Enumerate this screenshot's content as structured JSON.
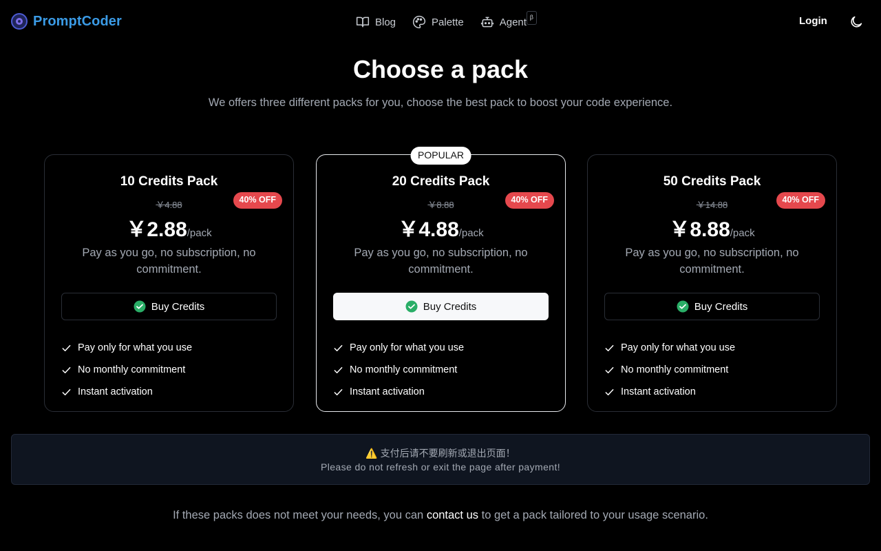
{
  "brand": {
    "name": "PromptCoder",
    "logo_icon": "brand-logo-icon"
  },
  "nav": {
    "items": [
      {
        "label": "Blog",
        "icon": "book-icon"
      },
      {
        "label": "Palette",
        "icon": "palette-icon"
      },
      {
        "label": "Agent",
        "icon": "bot-icon",
        "badge": "β"
      }
    ],
    "login_label": "Login",
    "theme_icon": "moon-icon"
  },
  "hero": {
    "title": "Choose a pack",
    "subtitle": "We offers three different packs for you, choose the best pack to boost your code experience."
  },
  "packs": [
    {
      "title": "10 Credits Pack",
      "old_price": "￥4.88",
      "discount": "40% OFF",
      "price": "￥2.88",
      "per": "/pack",
      "description": "Pay as you go, no subscription, no commitment.",
      "button": "Buy Credits",
      "features": [
        "Pay only for what you use",
        "No monthly commitment",
        "Instant activation"
      ]
    },
    {
      "title": "20 Credits Pack",
      "popular": "POPULAR",
      "old_price": "￥8.88",
      "discount": "40% OFF",
      "price": "￥4.88",
      "per": "/pack",
      "description": "Pay as you go, no subscription, no commitment.",
      "button": "Buy Credits",
      "features": [
        "Pay only for what you use",
        "No monthly commitment",
        "Instant activation"
      ]
    },
    {
      "title": "50 Credits Pack",
      "old_price": "￥14.88",
      "discount": "40% OFF",
      "price": "￥8.88",
      "per": "/pack",
      "description": "Pay as you go, no subscription, no commitment.",
      "button": "Buy Credits",
      "features": [
        "Pay only for what you use",
        "No monthly commitment",
        "Instant activation"
      ]
    }
  ],
  "notice": {
    "line_cn": "⚠️ 支付后请不要刷新或退出页面！",
    "line_en": "Please do not refresh or exit the page after payment!"
  },
  "footer": {
    "before": "If these packs does not meet your needs, you can ",
    "link": "contact us",
    "after": " to get a pack tailored to your usage scenario."
  },
  "colors": {
    "background": "#000000",
    "brand": "#3b9be6",
    "discount": "#e5484d",
    "wechat": "#2aae67",
    "muted_text": "#a3a9b3"
  }
}
